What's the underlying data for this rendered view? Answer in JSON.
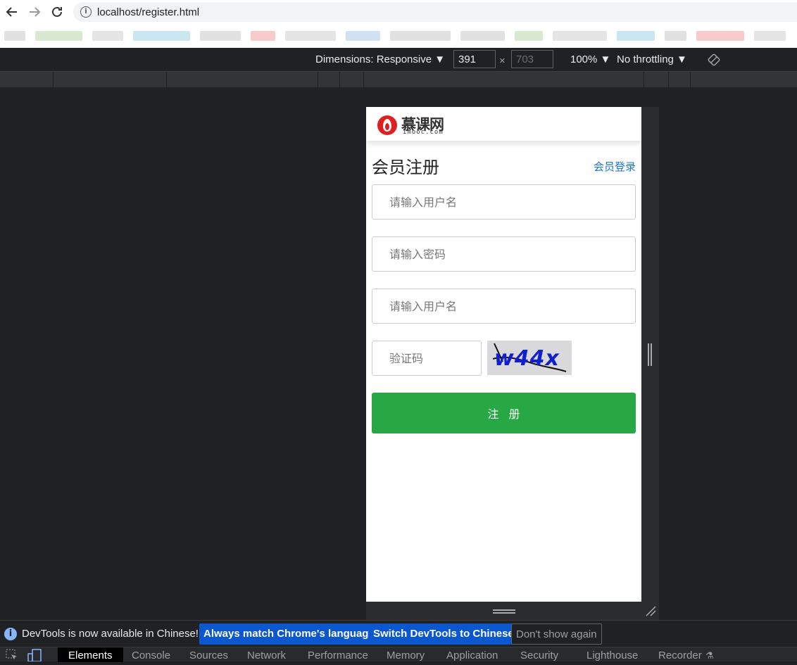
{
  "browser": {
    "url": "localhost/register.html",
    "back_icon": "arrow-left-icon",
    "forward_icon": "arrow-right-icon",
    "reload_icon": "reload-icon"
  },
  "device_toolbar": {
    "dimensions_label": "Dimensions: Responsive ▼",
    "width_value": "391",
    "height_value": "703",
    "separator": "×",
    "zoom_label": "100% ▼",
    "throttle_label": "No throttling ▼"
  },
  "site": {
    "logo_text": "慕课网",
    "logo_subtext": "imooc.com",
    "page_title": "会员注册",
    "login_link": "会员登录",
    "fields": {
      "username_placeholder": "请输入用户名",
      "password_placeholder": "请输入密码",
      "username2_placeholder": "请输入用户名",
      "captcha_placeholder": "验证码"
    },
    "captcha_image_text": "w44x",
    "submit_label": "注册",
    "colors": {
      "button": "#28a745",
      "link": "#1a73e8",
      "logo": "#e02020"
    }
  },
  "infobar": {
    "message": "DevTools is now available in Chinese!",
    "btn_match": "Always match Chrome's language",
    "btn_switch": "Switch DevTools to Chinese",
    "btn_dismiss": "Don't show again"
  },
  "devtools_tabs": [
    "Elements",
    "Console",
    "Sources",
    "Network",
    "Performance",
    "Memory",
    "Application",
    "Security",
    "Lighthouse",
    "Recorder"
  ]
}
